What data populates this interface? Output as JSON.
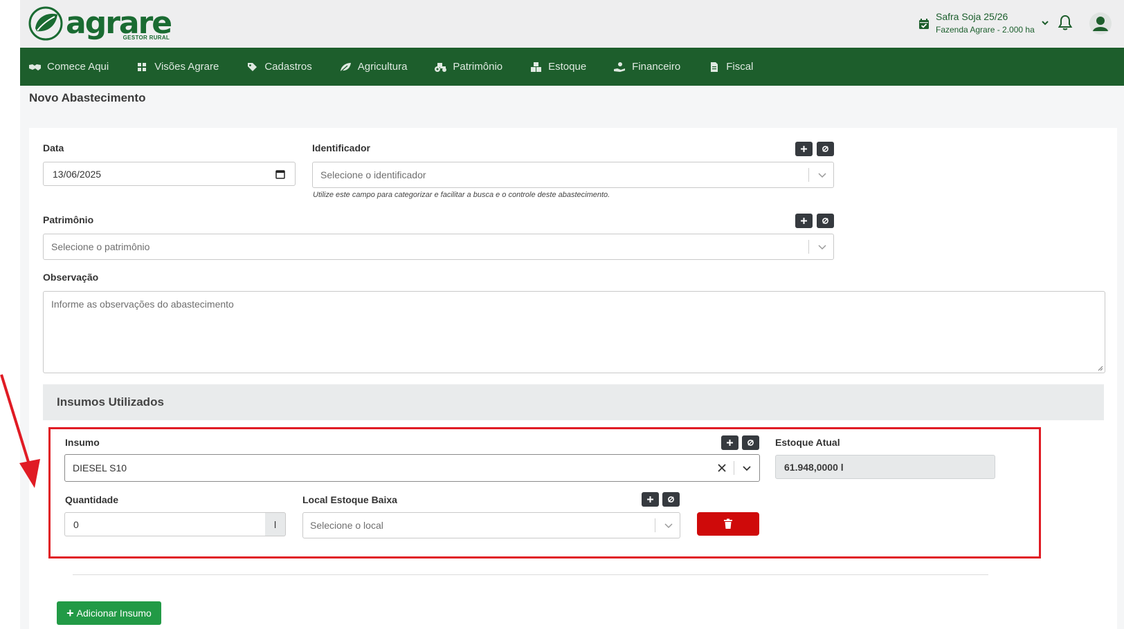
{
  "brand": {
    "name": "agrare",
    "tagline": "GESTOR RURAL",
    "color": "#1d5e2c"
  },
  "header": {
    "safra_title": "Safra Soja 25/26",
    "safra_subtitle": "Fazenda Agrare - 2.000 ha",
    "icons": [
      "calendar-check-icon",
      "chevron-down-icon",
      "bell-icon",
      "user-avatar-icon"
    ]
  },
  "nav": {
    "items": [
      {
        "label": "Comece Aqui",
        "icon": "handshake-icon"
      },
      {
        "label": "Visões Agrare",
        "icon": "dashboard-icon"
      },
      {
        "label": "Cadastros",
        "icon": "tag-icon"
      },
      {
        "label": "Agricultura",
        "icon": "leaf-icon"
      },
      {
        "label": "Patrimônio",
        "icon": "tractor-icon"
      },
      {
        "label": "Estoque",
        "icon": "boxes-icon"
      },
      {
        "label": "Financeiro",
        "icon": "hand-coin-icon"
      },
      {
        "label": "Fiscal",
        "icon": "document-icon"
      }
    ]
  },
  "page": {
    "title": "Novo Abastecimento"
  },
  "form": {
    "data_label": "Data",
    "data_value": "13/06/2025",
    "identificador_label": "Identificador",
    "identificador_placeholder": "Selecione o identificador",
    "identificador_hint": "Utilize este campo para categorizar e facilitar a busca e o controle deste abastecimento.",
    "patrimonio_label": "Patrimônio",
    "patrimonio_placeholder": "Selecione o patrimônio",
    "observacao_label": "Observação",
    "observacao_placeholder": "Informe as observações do abastecimento"
  },
  "insumos": {
    "section_title": "Insumos Utilizados",
    "insumo_label": "Insumo",
    "insumo_value": "DIESEL S10",
    "estoque_label": "Estoque Atual",
    "estoque_value": "61.948,0000 l",
    "quantidade_label": "Quantidade",
    "quantidade_value": "0",
    "quantidade_unit": "l",
    "local_label": "Local Estoque Baixa",
    "local_placeholder": "Selecione o local",
    "add_button": "Adicionar Insumo"
  },
  "colors": {
    "highlight": "#e01b24",
    "danger": "#cf0a0a",
    "success": "#229a46"
  }
}
